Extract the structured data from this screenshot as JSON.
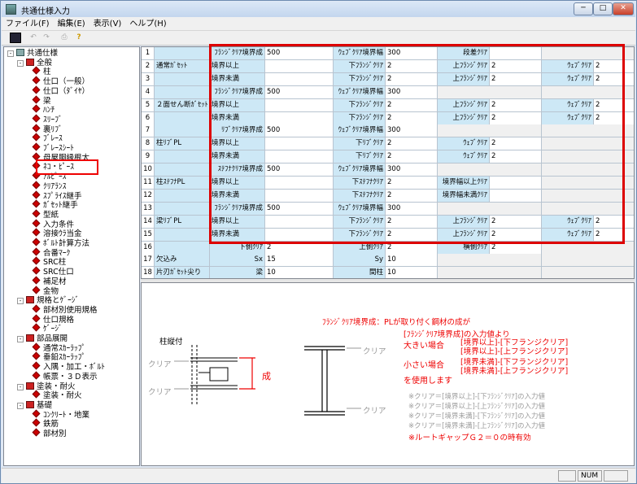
{
  "window": {
    "title": "共通仕様入力",
    "controls": [
      "─",
      "□",
      "✕"
    ]
  },
  "menu": [
    "ファイル(F)",
    "編集(E)",
    "表示(V)",
    "ヘルプ(H)"
  ],
  "toolbar": {
    "save": "save-icon",
    "undo": "undo-icon",
    "redo": "redo-icon",
    "print": "print-icon",
    "help": "help-icon"
  },
  "tree": [
    {
      "text": "共通仕様",
      "level": 0,
      "icon": "pc",
      "exp": "-"
    },
    {
      "text": "全般",
      "level": 1,
      "icon": "bk",
      "exp": "-"
    },
    {
      "text": "柱",
      "level": 2,
      "icon": "dia"
    },
    {
      "text": "仕口（一般）",
      "level": 2,
      "icon": "dia"
    },
    {
      "text": "仕口（ﾀﾞｲﾔ）",
      "level": 2,
      "icon": "dia"
    },
    {
      "text": "梁",
      "level": 2,
      "icon": "dia"
    },
    {
      "text": "ﾊﾝﾁ",
      "level": 2,
      "icon": "dia"
    },
    {
      "text": "ｽﾘｰﾌﾞ",
      "level": 2,
      "icon": "dia"
    },
    {
      "text": "裏ﾘﾌﾞ",
      "level": 2,
      "icon": "dia"
    },
    {
      "text": "ﾌﾞﾚｰｽ",
      "level": 2,
      "icon": "dia"
    },
    {
      "text": "ﾌﾞﾚｰｽｼｰﾄ",
      "level": 2,
      "icon": "dia"
    },
    {
      "text": "母屋胴縁根太",
      "level": 2,
      "icon": "dia"
    },
    {
      "text": "ﾈｺ・ﾋﾟｰｽ",
      "level": 2,
      "icon": "dia"
    },
    {
      "text": "ｱﾙﾋﾟｰｽ",
      "level": 2,
      "icon": "dia"
    },
    {
      "text": "ｸﾘｱﾗﾝｽ",
      "level": 2,
      "icon": "dia"
    },
    {
      "text": "ｽﾌﾟﾗｲｽ継手",
      "level": 2,
      "icon": "dia"
    },
    {
      "text": "ｶﾞｾｯﾄ継手",
      "level": 2,
      "icon": "dia"
    },
    {
      "text": "型紙",
      "level": 2,
      "icon": "dia"
    },
    {
      "text": "入力条件",
      "level": 2,
      "icon": "dia"
    },
    {
      "text": "溶接ｳﾗ当金",
      "level": 2,
      "icon": "dia"
    },
    {
      "text": "ﾎﾞﾙﾄ計算方法",
      "level": 2,
      "icon": "dia"
    },
    {
      "text": "合番ﾏｰｸ",
      "level": 2,
      "icon": "dia"
    },
    {
      "text": "SRC柱",
      "level": 2,
      "icon": "dia"
    },
    {
      "text": "SRC仕口",
      "level": 2,
      "icon": "dia"
    },
    {
      "text": "補足材",
      "level": 2,
      "icon": "dia"
    },
    {
      "text": "金物",
      "level": 2,
      "icon": "dia"
    },
    {
      "text": "規格とｹﾞｰｼﾞ",
      "level": 1,
      "icon": "bk",
      "exp": "-"
    },
    {
      "text": "部材別使用規格",
      "level": 2,
      "icon": "dia"
    },
    {
      "text": "仕口規格",
      "level": 2,
      "icon": "dia"
    },
    {
      "text": "ｹﾞｰｼﾞ",
      "level": 2,
      "icon": "dia"
    },
    {
      "text": "部品展開",
      "level": 1,
      "icon": "bk",
      "exp": "-"
    },
    {
      "text": "通常ｽｶｰﾗｯﾌﾟ",
      "level": 2,
      "icon": "dia"
    },
    {
      "text": "垂鉛ｽｶｰﾗｯﾌﾟ",
      "level": 2,
      "icon": "dia"
    },
    {
      "text": "入隅・加工・ﾎﾞﾙﾄ",
      "level": 2,
      "icon": "dia"
    },
    {
      "text": "帳票・３Ｄ表示",
      "level": 2,
      "icon": "dia"
    },
    {
      "text": "塗装・耐火",
      "level": 1,
      "icon": "bk",
      "exp": "-"
    },
    {
      "text": "塗装・耐火",
      "level": 2,
      "icon": "dia"
    },
    {
      "text": "基礎",
      "level": 1,
      "icon": "bk",
      "exp": "-"
    },
    {
      "text": "ｺﾝｸﾘｰﾄ・地業",
      "level": 2,
      "icon": "dia"
    },
    {
      "text": "鉄筋",
      "level": 2,
      "icon": "dia"
    },
    {
      "text": "部材別",
      "level": 2,
      "icon": "dia"
    }
  ],
  "grid": {
    "rows": [
      {
        "n": "1",
        "grp": "",
        "cells": [
          [
            "ﾌﾗﾝｼﾞｸﾘｱ境界成",
            "500"
          ],
          [
            "ｳｪﾌﾞｸﾘｱ境界幅",
            "300"
          ],
          [
            "段差ｸﾘｱ",
            ""
          ],
          [
            "",
            ""
          ]
        ]
      },
      {
        "n": "2",
        "grp": "通常ｶﾞｾｯﾄ",
        "cells": [
          [
            "境界以上",
            ""
          ],
          [
            "下ﾌﾗﾝｼﾞｸﾘｱ",
            "2"
          ],
          [
            "上ﾌﾗﾝｼﾞｸﾘｱ",
            "2"
          ],
          [
            "ｳｪﾌﾞｸﾘｱ",
            "2"
          ]
        ]
      },
      {
        "n": "3",
        "grp": "",
        "cells": [
          [
            "境界未満",
            ""
          ],
          [
            "下ﾌﾗﾝｼﾞｸﾘｱ",
            "2"
          ],
          [
            "上ﾌﾗﾝｼﾞｸﾘｱ",
            "2"
          ],
          [
            "ｳｪﾌﾞｸﾘｱ",
            "2"
          ]
        ]
      },
      {
        "n": "4",
        "grp": "",
        "cells": [
          [
            "ﾌﾗﾝｼﾞｸﾘｱ境界成",
            "500"
          ],
          [
            "ｳｪﾌﾞｸﾘｱ境界幅",
            "300"
          ],
          [
            "",
            ""
          ],
          [
            "",
            ""
          ]
        ]
      },
      {
        "n": "5",
        "grp": "２面せん断ｶﾞｾｯﾄ",
        "cells": [
          [
            "境界以上",
            ""
          ],
          [
            "下ﾌﾗﾝｼﾞｸﾘｱ",
            "2"
          ],
          [
            "上ﾌﾗﾝｼﾞｸﾘｱ",
            "2"
          ],
          [
            "ｳｪﾌﾞｸﾘｱ",
            "2"
          ]
        ]
      },
      {
        "n": "6",
        "grp": "",
        "cells": [
          [
            "境界未満",
            ""
          ],
          [
            "下ﾌﾗﾝｼﾞｸﾘｱ",
            "2"
          ],
          [
            "上ﾌﾗﾝｼﾞｸﾘｱ",
            "2"
          ],
          [
            "ｳｪﾌﾞｸﾘｱ",
            "2"
          ]
        ]
      },
      {
        "n": "7",
        "grp": "",
        "cells": [
          [
            "ﾘﾌﾞｸﾘｱ境界成",
            "500"
          ],
          [
            "ｳｪﾌﾞｸﾘｱ境界幅",
            "300"
          ],
          [
            "",
            ""
          ],
          [
            "",
            ""
          ]
        ]
      },
      {
        "n": "8",
        "grp": "柱ﾘﾌﾞPL",
        "cells": [
          [
            "境界以上",
            ""
          ],
          [
            "下ﾘﾌﾞｸﾘｱ",
            "2"
          ],
          [
            "ｳｪﾌﾞｸﾘｱ",
            "2"
          ],
          [
            "",
            ""
          ]
        ]
      },
      {
        "n": "9",
        "grp": "",
        "cells": [
          [
            "境界未満",
            ""
          ],
          [
            "下ﾘﾌﾞｸﾘｱ",
            "2"
          ],
          [
            "ｳｪﾌﾞｸﾘｱ",
            "2"
          ],
          [
            "",
            ""
          ]
        ]
      },
      {
        "n": "10",
        "grp": "",
        "cells": [
          [
            "ｽﾃﾌﾅｸﾘｱ境界成",
            "500"
          ],
          [
            "ｳｪﾌﾞｸﾘｱ境界幅",
            "300"
          ],
          [
            "",
            ""
          ],
          [
            "",
            ""
          ]
        ]
      },
      {
        "n": "11",
        "grp": "柱ｽﾃﾌﾅPL",
        "cells": [
          [
            "境界以上",
            ""
          ],
          [
            "下ｽﾃﾌﾅｸﾘｱ",
            "2"
          ],
          [
            "境界幅以上ｸﾘｱ",
            ""
          ],
          [
            "",
            ""
          ]
        ]
      },
      {
        "n": "12",
        "grp": "",
        "cells": [
          [
            "境界未満",
            ""
          ],
          [
            "下ｽﾃﾌﾅｸﾘｱ",
            "2"
          ],
          [
            "境界幅未満ｸﾘｱ",
            ""
          ],
          [
            "",
            ""
          ]
        ]
      },
      {
        "n": "13",
        "grp": "",
        "cells": [
          [
            "ﾌﾗﾝｼﾞｸﾘｱ境界成",
            "500"
          ],
          [
            "ｳｪﾌﾞｸﾘｱ境界幅",
            "300"
          ],
          [
            "",
            ""
          ],
          [
            "",
            ""
          ]
        ]
      },
      {
        "n": "14",
        "grp": "梁ﾘﾌﾞPL",
        "cells": [
          [
            "境界以上",
            ""
          ],
          [
            "下ﾌﾗﾝｼﾞｸﾘｱ",
            "2"
          ],
          [
            "上ﾌﾗﾝｼﾞｸﾘｱ",
            "2"
          ],
          [
            "ｳｪﾌﾞｸﾘｱ",
            "2"
          ]
        ]
      },
      {
        "n": "15",
        "grp": "",
        "cells": [
          [
            "境界未満",
            ""
          ],
          [
            "下ﾌﾗﾝｼﾞｸﾘｱ",
            "2"
          ],
          [
            "上ﾌﾗﾝｼﾞｸﾘｱ",
            "2"
          ],
          [
            "ｳｪﾌﾞｸﾘｱ",
            "2"
          ]
        ]
      },
      {
        "n": "16",
        "grp": "",
        "cells": [
          [
            "下側ｸﾘｱ",
            "2"
          ],
          [
            "上側ｸﾘｱ",
            "2"
          ],
          [
            "横側ｸﾘｱ",
            "2"
          ],
          [
            "",
            ""
          ]
        ]
      },
      {
        "n": "17",
        "grp": "欠込み",
        "cells": [
          [
            "Sx",
            "15"
          ],
          [
            "Sy",
            "10"
          ],
          [
            "",
            ""
          ],
          [
            "",
            ""
          ]
        ]
      },
      {
        "n": "18",
        "grp": "片刃ｶﾞｾｯﾄ尖り",
        "cells": [
          [
            "梁",
            "10"
          ],
          [
            "間柱",
            "10"
          ],
          [
            "",
            ""
          ],
          [
            "",
            ""
          ]
        ]
      }
    ]
  },
  "diagram": {
    "note1": "ﾌﾗﾝｼﾞｸﾘｱ境界成：PLが取り付く鋼材の成が",
    "note2": "[ﾌﾗﾝｼﾞｸﾘｱ境界成]の入力値より",
    "big": "大きい場合",
    "small": "小さい場合",
    "b1": "[境界以上]-[下フランジクリア]",
    "b2": "[境界以上]-[上フランジクリア]",
    "s1": "[境界未満]-[下フランジクリア]",
    "s2": "[境界未満]-[上フランジクリア]",
    "use": "を使用します",
    "col": "柱縦付",
    "clr1": "クリア",
    "clr2": "クリア",
    "clr3": "クリア",
    "clr4": "クリア",
    "sei": "成",
    "g1": "※クリア＝[境界以上]-[下ﾌﾗﾝｼﾞｸﾘｱ]の入力値",
    "g2": "※クリア＝[境界以上]-[上ﾌﾗﾝｼﾞｸﾘｱ]の入力値",
    "g3": "※クリア＝[境界未満]-[下ﾌﾗﾝｼﾞｸﾘｱ]の入力値",
    "g4": "※クリア＝[境界未満]-[上ﾌﾗﾝｼﾞｸﾘｱ]の入力値",
    "root": "※ルートギャップＧ２＝０の時有効"
  },
  "status": {
    "num": "NUM"
  }
}
